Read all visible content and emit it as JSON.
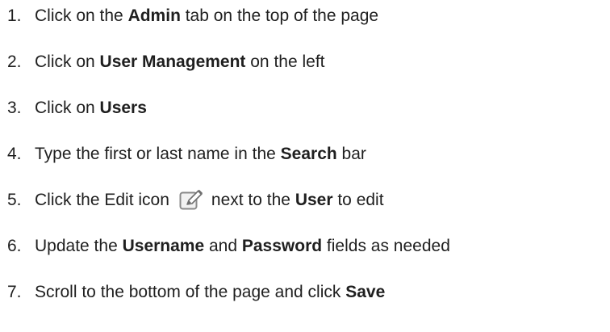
{
  "steps": [
    {
      "num": "1.",
      "before": "Click on the ",
      "bold": "Admin",
      "after": " tab on the top of the page"
    },
    {
      "num": "2.",
      "before": "Click on ",
      "bold": "User Management",
      "after": " on the left"
    },
    {
      "num": "3.",
      "before": "Click on ",
      "bold": "Users",
      "after": ""
    },
    {
      "num": "4.",
      "before": "Type the first or last name in the ",
      "bold": "Search",
      "after": " bar"
    },
    {
      "num": "5.",
      "before": "Click the Edit icon",
      "icon": "edit-icon",
      "middle": "next to the ",
      "bold": "User",
      "after": " to edit"
    },
    {
      "num": "6.",
      "before": "Update the ",
      "bold": "Username",
      "middle": " and ",
      "bold2": "Password",
      "after": " fields as needed"
    },
    {
      "num": "7.",
      "before": "Scroll to the bottom of the page and click ",
      "bold": "Save",
      "after": ""
    }
  ],
  "colors": {
    "text": "#1f1f1f",
    "icon_border": "#8a8a8a",
    "icon_fill": "#f2f2f2"
  }
}
